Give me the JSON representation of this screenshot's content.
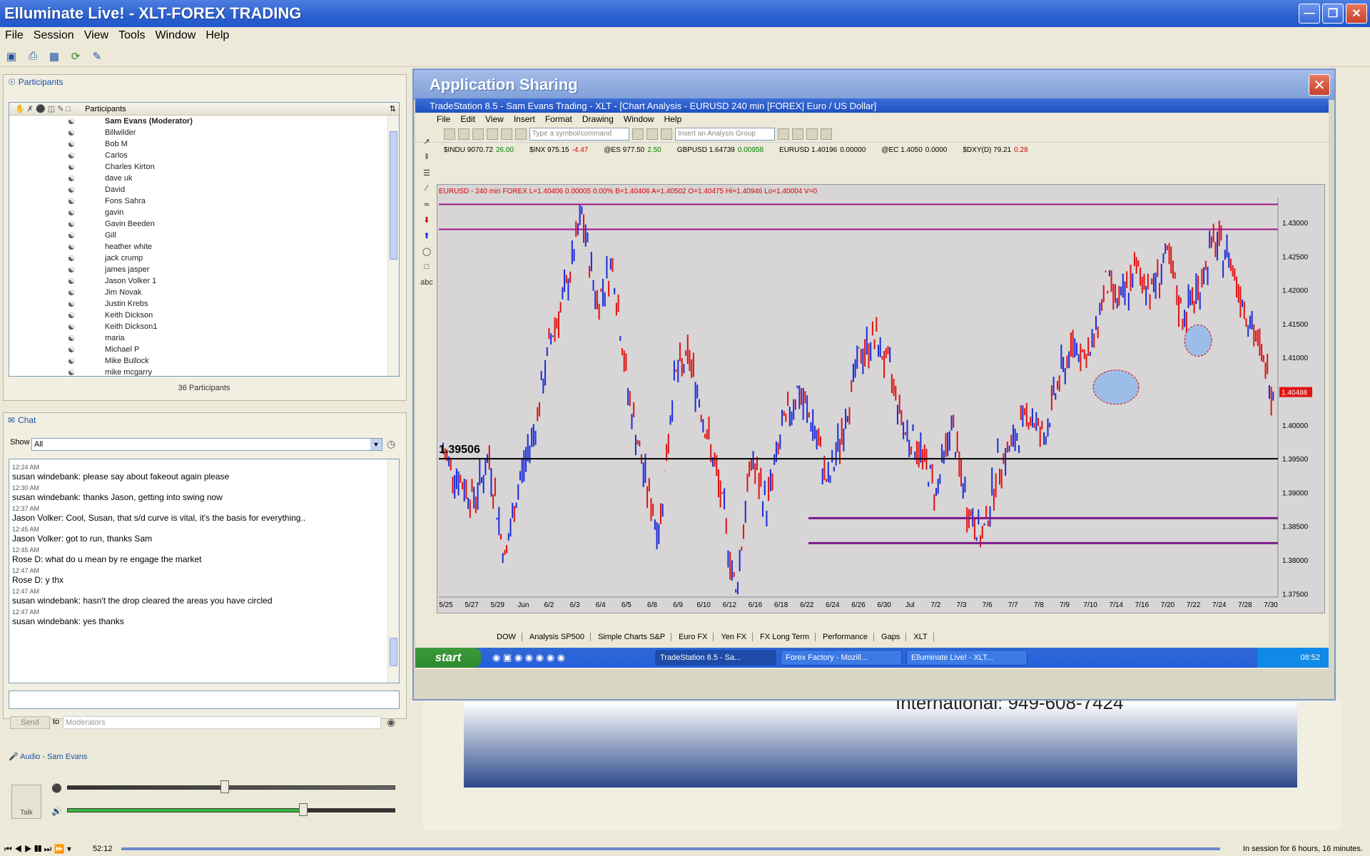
{
  "window": {
    "title": "Elluminate Live! - XLT-FOREX TRADING"
  },
  "menu": [
    "File",
    "Session",
    "View",
    "Tools",
    "Window",
    "Help"
  ],
  "participants": {
    "header": "Participants",
    "column": "Participants",
    "count": "36 Participants",
    "names": [
      "Sam Evans (Moderator)",
      "Billwilder",
      "Bob M",
      "Carlos",
      "Charles Kirton",
      "dave uk",
      "David",
      "Fons Sahra",
      "gavin",
      "Gavin Beeden",
      "Gill",
      "heather white",
      "jack crump",
      "james jasper",
      "Jason Volker 1",
      "Jim Novak",
      "Justin Krebs",
      "Keith Dickson",
      "Keith Dickson1",
      "maria",
      "Michael P",
      "Mike Bullock",
      "mike mcgarry"
    ]
  },
  "chat": {
    "header": "Chat",
    "show_label": "Show",
    "show_value": "All",
    "messages": [
      {
        "time": "12:24 AM",
        "text": "susan windebank: please say about fakeout again please"
      },
      {
        "time": "12:30 AM",
        "text": "susan windebank: thanks Jason, getting into swing now"
      },
      {
        "time": "12:37 AM",
        "text": "Jason Volker: Cool, Susan, that s/d curve is vital, it's the basis for everything.."
      },
      {
        "time": "12:45 AM",
        "text": "Jason Volker: got to run, thanks Sam"
      },
      {
        "time": "12:45 AM",
        "text": "Rose D: what do u mean by re engage the market"
      },
      {
        "time": "12:47 AM",
        "text": "Rose D: y thx"
      },
      {
        "time": "12:47 AM",
        "text": "susan windebank: hasn't the drop cleared the areas you have circled"
      },
      {
        "time": "12:47 AM",
        "text": "susan windebank: yes thanks"
      }
    ],
    "send_label": "Send",
    "to_label": "to",
    "to_value": "Moderators"
  },
  "audio": {
    "header": "Audio - Sam Evans",
    "talk_label": "Talk",
    "level_in": 0.48,
    "level_out": 0.72
  },
  "app_sharing": {
    "title": "Application Sharing"
  },
  "tradestation": {
    "title": "TradeStation 8.5 - Sam Evans Trading - XLT - [Chart Analysis - EURUSD 240 min [FOREX] Euro / US Dollar]",
    "menu": [
      "File",
      "Edit",
      "View",
      "Insert",
      "Format",
      "Drawing",
      "Window",
      "Help"
    ],
    "symbol_placeholder": "Type a symbol/command",
    "analysis_placeholder": "Insert an Analysis Group",
    "quotes": [
      {
        "sym": "$INDU 9070.72",
        "chg": "26.00",
        "dir": "up"
      },
      {
        "sym": "$INX 975.15",
        "chg": "-4.47",
        "dir": "dn"
      },
      {
        "sym": "@ES 977.50",
        "chg": "2.50",
        "dir": "up"
      },
      {
        "sym": "GBPUSD 1.64739",
        "chg": "0.00958",
        "dir": "up"
      },
      {
        "sym": "EURUSD 1.40196",
        "chg": "0.00000",
        "dir": "none"
      },
      {
        "sym": "@EC 1.4050",
        "chg": "0.0000",
        "dir": "none"
      },
      {
        "sym": "$DXY(D) 79.21",
        "chg": "0.28",
        "dir": "dn"
      }
    ],
    "chart_header": "EURUSD - 240 min FOREX  L=1.40406  0.00005  0.00%  B=1.40406  A=1.40502  O=1.40475  Hi=1.40946  Lo=1.40004  V=0",
    "chart_label": "1.39506",
    "price_tag": "1.40488",
    "sheet_tabs": [
      "DOW",
      "Analysis SP500",
      "Simple Charts S&P",
      "Euro FX",
      "Yen FX",
      "FX Long Term",
      "Performance",
      "Gaps",
      "XLT"
    ],
    "taskbar": {
      "start": "start",
      "tasks": [
        "TradeStation 8.5 - Sa...",
        "Forex Factory - Mozill...",
        "Elluminate Live! - XLT..."
      ],
      "clock": "08:52"
    }
  },
  "slide": {
    "text": "International: 949-608-7424"
  },
  "status": {
    "elapsed": "52:12",
    "session": "In session for 6 hours, 16 minutes."
  },
  "chart_data": {
    "type": "line",
    "x_ticks": [
      "5/25",
      "5/27",
      "5/29",
      "Jun",
      "6/2",
      "6/3",
      "6/4",
      "6/5",
      "6/8",
      "6/9",
      "6/10",
      "6/12",
      "6/16",
      "6/18",
      "6/22",
      "6/24",
      "6/26",
      "6/30",
      "Jul",
      "7/2",
      "7/3",
      "7/6",
      "7/7",
      "7/8",
      "7/9",
      "7/10",
      "7/14",
      "7/16",
      "7/20",
      "7/22",
      "7/24",
      "7/28",
      "7/30"
    ],
    "y_ticks": [
      1.43,
      1.425,
      1.42,
      1.415,
      1.41,
      1.405,
      1.4,
      1.395,
      1.39,
      1.385,
      1.38,
      1.375
    ],
    "ylim": [
      1.3745,
      1.4337
    ],
    "series": [
      {
        "values": [
          1.396,
          1.392,
          1.389,
          1.395,
          1.38,
          1.392,
          1.4,
          1.413,
          1.42,
          1.431,
          1.418,
          1.424,
          1.405,
          1.393,
          1.384,
          1.407,
          1.41,
          1.4,
          1.39,
          1.375,
          1.395,
          1.388,
          1.399,
          1.405,
          1.4,
          1.391,
          1.4,
          1.41,
          1.413,
          1.408,
          1.399,
          1.396,
          1.39,
          1.4,
          1.388,
          1.383,
          1.394,
          1.397,
          1.402,
          1.398,
          1.407,
          1.412,
          1.41,
          1.421,
          1.418,
          1.423,
          1.42,
          1.425,
          1.416,
          1.42,
          1.427,
          1.425,
          1.418,
          1.411,
          1.404
        ]
      }
    ],
    "hlines": [
      1.4327,
      1.429,
      1.395,
      1.3862,
      1.3825
    ],
    "colors": {
      "up": "#1a2bd8",
      "down": "#e01212",
      "resistance": "#a0158c",
      "support": "#7b1a8a",
      "level": "#000000",
      "zone": "#9cbde8"
    }
  }
}
